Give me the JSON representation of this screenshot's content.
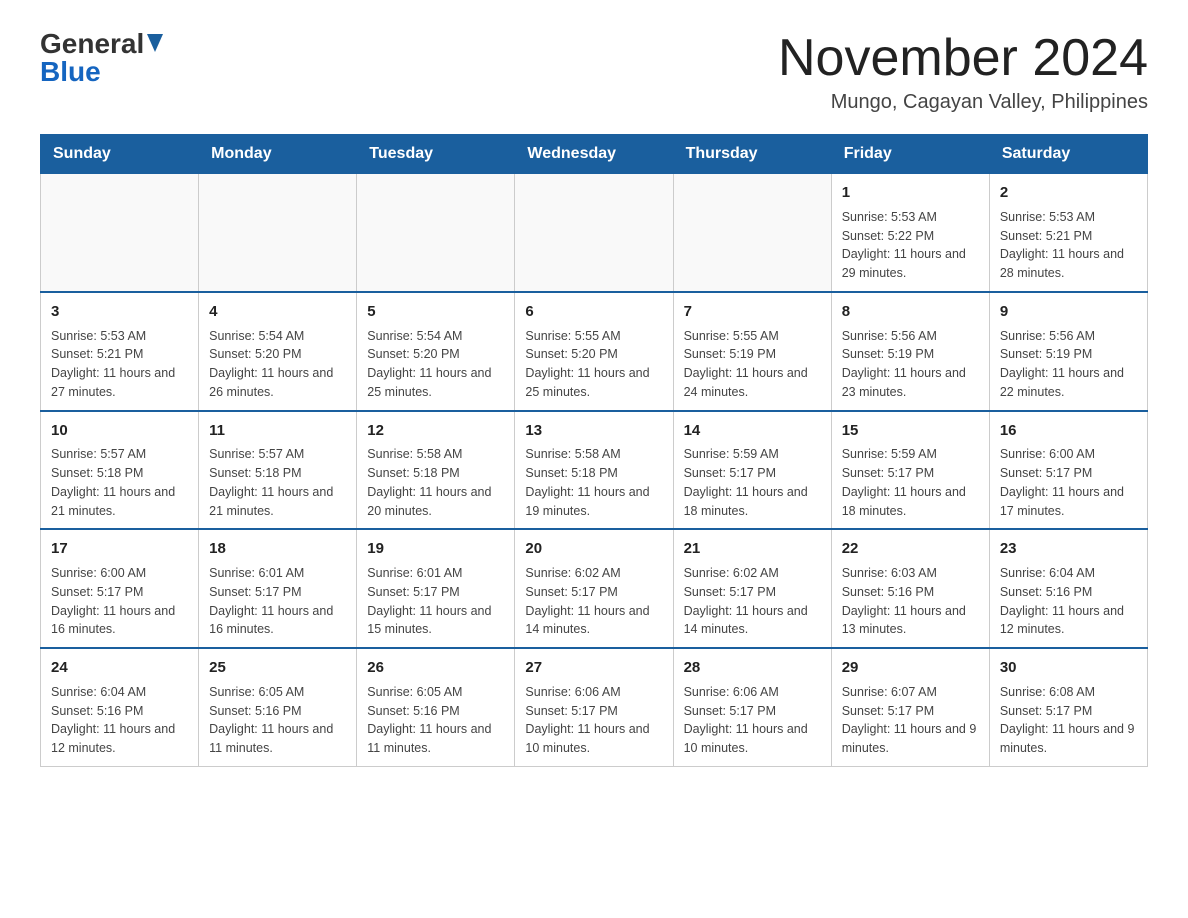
{
  "logo": {
    "general": "General",
    "blue": "Blue"
  },
  "title": "November 2024",
  "location": "Mungo, Cagayan Valley, Philippines",
  "weekdays": [
    "Sunday",
    "Monday",
    "Tuesday",
    "Wednesday",
    "Thursday",
    "Friday",
    "Saturday"
  ],
  "weeks": [
    [
      {
        "day": "",
        "info": ""
      },
      {
        "day": "",
        "info": ""
      },
      {
        "day": "",
        "info": ""
      },
      {
        "day": "",
        "info": ""
      },
      {
        "day": "",
        "info": ""
      },
      {
        "day": "1",
        "info": "Sunrise: 5:53 AM\nSunset: 5:22 PM\nDaylight: 11 hours and 29 minutes."
      },
      {
        "day": "2",
        "info": "Sunrise: 5:53 AM\nSunset: 5:21 PM\nDaylight: 11 hours and 28 minutes."
      }
    ],
    [
      {
        "day": "3",
        "info": "Sunrise: 5:53 AM\nSunset: 5:21 PM\nDaylight: 11 hours and 27 minutes."
      },
      {
        "day": "4",
        "info": "Sunrise: 5:54 AM\nSunset: 5:20 PM\nDaylight: 11 hours and 26 minutes."
      },
      {
        "day": "5",
        "info": "Sunrise: 5:54 AM\nSunset: 5:20 PM\nDaylight: 11 hours and 25 minutes."
      },
      {
        "day": "6",
        "info": "Sunrise: 5:55 AM\nSunset: 5:20 PM\nDaylight: 11 hours and 25 minutes."
      },
      {
        "day": "7",
        "info": "Sunrise: 5:55 AM\nSunset: 5:19 PM\nDaylight: 11 hours and 24 minutes."
      },
      {
        "day": "8",
        "info": "Sunrise: 5:56 AM\nSunset: 5:19 PM\nDaylight: 11 hours and 23 minutes."
      },
      {
        "day": "9",
        "info": "Sunrise: 5:56 AM\nSunset: 5:19 PM\nDaylight: 11 hours and 22 minutes."
      }
    ],
    [
      {
        "day": "10",
        "info": "Sunrise: 5:57 AM\nSunset: 5:18 PM\nDaylight: 11 hours and 21 minutes."
      },
      {
        "day": "11",
        "info": "Sunrise: 5:57 AM\nSunset: 5:18 PM\nDaylight: 11 hours and 21 minutes."
      },
      {
        "day": "12",
        "info": "Sunrise: 5:58 AM\nSunset: 5:18 PM\nDaylight: 11 hours and 20 minutes."
      },
      {
        "day": "13",
        "info": "Sunrise: 5:58 AM\nSunset: 5:18 PM\nDaylight: 11 hours and 19 minutes."
      },
      {
        "day": "14",
        "info": "Sunrise: 5:59 AM\nSunset: 5:17 PM\nDaylight: 11 hours and 18 minutes."
      },
      {
        "day": "15",
        "info": "Sunrise: 5:59 AM\nSunset: 5:17 PM\nDaylight: 11 hours and 18 minutes."
      },
      {
        "day": "16",
        "info": "Sunrise: 6:00 AM\nSunset: 5:17 PM\nDaylight: 11 hours and 17 minutes."
      }
    ],
    [
      {
        "day": "17",
        "info": "Sunrise: 6:00 AM\nSunset: 5:17 PM\nDaylight: 11 hours and 16 minutes."
      },
      {
        "day": "18",
        "info": "Sunrise: 6:01 AM\nSunset: 5:17 PM\nDaylight: 11 hours and 16 minutes."
      },
      {
        "day": "19",
        "info": "Sunrise: 6:01 AM\nSunset: 5:17 PM\nDaylight: 11 hours and 15 minutes."
      },
      {
        "day": "20",
        "info": "Sunrise: 6:02 AM\nSunset: 5:17 PM\nDaylight: 11 hours and 14 minutes."
      },
      {
        "day": "21",
        "info": "Sunrise: 6:02 AM\nSunset: 5:17 PM\nDaylight: 11 hours and 14 minutes."
      },
      {
        "day": "22",
        "info": "Sunrise: 6:03 AM\nSunset: 5:16 PM\nDaylight: 11 hours and 13 minutes."
      },
      {
        "day": "23",
        "info": "Sunrise: 6:04 AM\nSunset: 5:16 PM\nDaylight: 11 hours and 12 minutes."
      }
    ],
    [
      {
        "day": "24",
        "info": "Sunrise: 6:04 AM\nSunset: 5:16 PM\nDaylight: 11 hours and 12 minutes."
      },
      {
        "day": "25",
        "info": "Sunrise: 6:05 AM\nSunset: 5:16 PM\nDaylight: 11 hours and 11 minutes."
      },
      {
        "day": "26",
        "info": "Sunrise: 6:05 AM\nSunset: 5:16 PM\nDaylight: 11 hours and 11 minutes."
      },
      {
        "day": "27",
        "info": "Sunrise: 6:06 AM\nSunset: 5:17 PM\nDaylight: 11 hours and 10 minutes."
      },
      {
        "day": "28",
        "info": "Sunrise: 6:06 AM\nSunset: 5:17 PM\nDaylight: 11 hours and 10 minutes."
      },
      {
        "day": "29",
        "info": "Sunrise: 6:07 AM\nSunset: 5:17 PM\nDaylight: 11 hours and 9 minutes."
      },
      {
        "day": "30",
        "info": "Sunrise: 6:08 AM\nSunset: 5:17 PM\nDaylight: 11 hours and 9 minutes."
      }
    ]
  ]
}
